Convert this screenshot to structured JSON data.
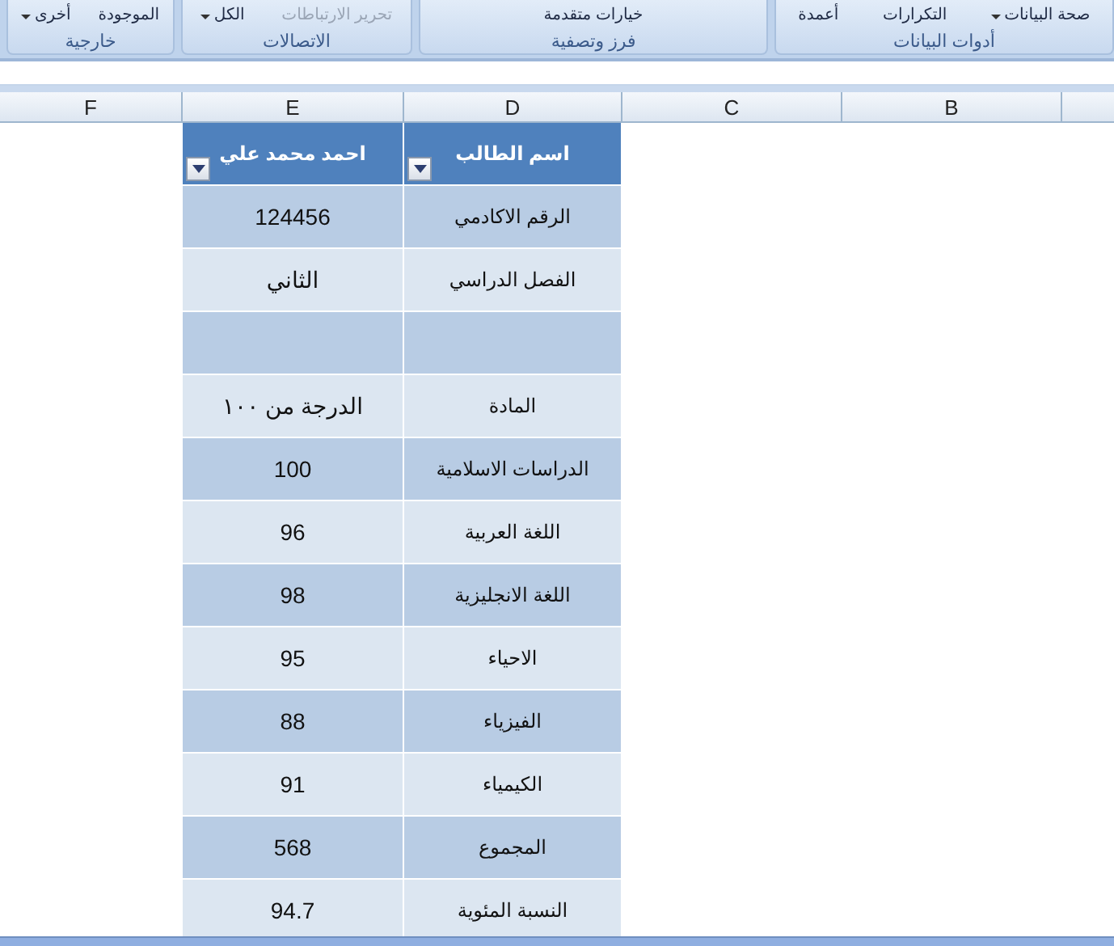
{
  "ribbon": {
    "groups": [
      {
        "label": "أدوات البيانات",
        "commands": [
          {
            "text": "صحة البيانات",
            "dropdown": true,
            "disabled": false
          },
          {
            "text": "التكرارات",
            "dropdown": false,
            "disabled": false
          },
          {
            "text": "أعمدة",
            "dropdown": false,
            "disabled": false
          }
        ]
      },
      {
        "label": "فرز وتصفية",
        "commands": [
          {
            "text": "خيارات متقدمة",
            "dropdown": false,
            "disabled": false
          }
        ]
      },
      {
        "label": "الاتصالات",
        "commands": [
          {
            "text": "تحرير الارتباطات",
            "dropdown": false,
            "disabled": true
          },
          {
            "text": "الكل",
            "dropdown": true,
            "disabled": false
          }
        ]
      },
      {
        "label": "خارجية",
        "commands": [
          {
            "text": "الموجودة",
            "dropdown": false,
            "disabled": false
          },
          {
            "text": "أخرى",
            "dropdown": true,
            "disabled": false
          }
        ]
      }
    ]
  },
  "columns": [
    "B",
    "C",
    "D",
    "E",
    "F"
  ],
  "table": {
    "headers": [
      {
        "text": "اسم الطالب",
        "filter": true
      },
      {
        "text": "احمد محمد علي",
        "filter": true
      }
    ],
    "rows": [
      {
        "value": "124456",
        "label": "الرقم الاكادمي"
      },
      {
        "value": "الثاني",
        "label": "الفصل الدراسي"
      },
      {},
      {
        "value": "الدرجة من ١٠٠",
        "label": "المادة"
      },
      {
        "value": "100",
        "label": "الدراسات الاسلامية"
      },
      {
        "value": "96",
        "label": "اللغة العربية"
      },
      {
        "value": "98",
        "label": "اللغة الانجليزية"
      },
      {
        "value": "95",
        "label": "الاحياء"
      },
      {
        "value": "88",
        "label": "الفيزياء"
      },
      {
        "value": "91",
        "label": "الكيمياء"
      },
      {
        "value": "568",
        "label": "المجموع"
      },
      {
        "value": "94.7",
        "label": "النسبة المئوية"
      }
    ]
  }
}
